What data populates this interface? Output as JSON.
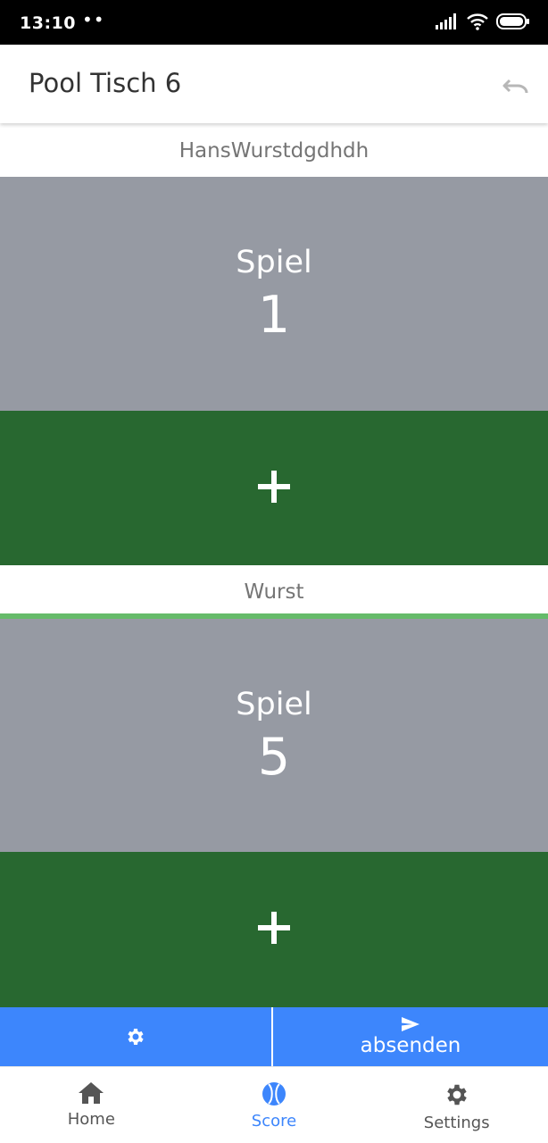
{
  "status_bar": {
    "time": "13:10",
    "dots": "••"
  },
  "app_bar": {
    "title": "Pool Tisch 6"
  },
  "players": [
    {
      "name": "HansWurstdgdhdh",
      "score_label": "Spiel",
      "score": "1",
      "plus_label": "+"
    },
    {
      "name": "Wurst",
      "score_label": "Spiel",
      "score": "5",
      "plus_label": "+"
    }
  ],
  "actions": {
    "send_label": "absenden"
  },
  "nav": [
    {
      "label": "Home",
      "icon": "home-icon"
    },
    {
      "label": "Score",
      "icon": "ball-icon",
      "active": true
    },
    {
      "label": "Settings",
      "icon": "gear-icon"
    }
  ],
  "colors": {
    "score_panel": "#969aa3",
    "plus_button": "#286830",
    "divider": "#66bb6a",
    "action_bar": "#3d86fc",
    "active_nav": "#3d86fc"
  }
}
